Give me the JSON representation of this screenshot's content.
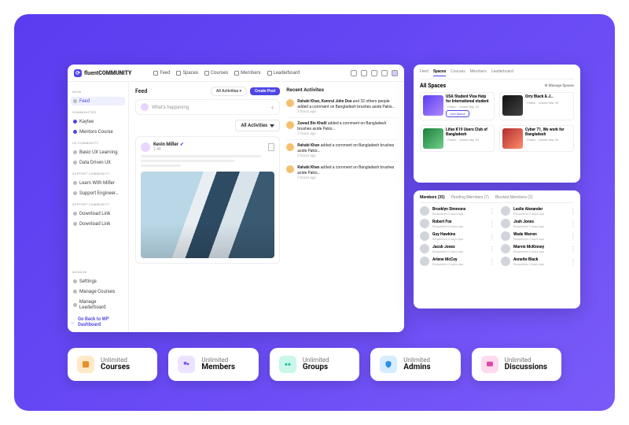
{
  "logo": {
    "brand_a": "fluent",
    "brand_b": "COMMUNITY"
  },
  "topnav": [
    {
      "label": "Feed"
    },
    {
      "label": "Spaces"
    },
    {
      "label": "Courses"
    },
    {
      "label": "Members"
    },
    {
      "label": "Leaderboard"
    }
  ],
  "sidebar": {
    "sections": {
      "main": "MAIN",
      "communities": "COMMUNITIES",
      "ux": "UX COMMUNITY",
      "support": "SUPPORT COMMUNITY",
      "support2": "SUPPORT COMMUNITY",
      "manage": "MANAGE"
    },
    "items": {
      "feed": "Feed",
      "kaytee": "Kaytee",
      "mentors": "Mentors Course",
      "basic_ux": "Basic UX Learning",
      "data_ux": "Data Driven UX",
      "learn_miller": "Learn With Miller",
      "support_eng": "Support Engineer…",
      "dl1": "Download Link",
      "dl2": "Download Link",
      "settings": "Settings",
      "manage_courses": "Manage Courses",
      "manage_leaderboard": "Manage Leaderboard",
      "go_back": "Go Back to WP Dashboard"
    }
  },
  "feed": {
    "title": "Feed",
    "all_activities_pill": "All Activities",
    "create_post": "Create Post",
    "composer_placeholder": "What's happening",
    "filter": "All Activities",
    "post": {
      "author": "Kevin Miller",
      "followers": "2.4K"
    }
  },
  "recent": {
    "title": "Recent Activites",
    "body_common": "Bangladesh brushes aside Pakis…",
    "action_common": "added a comment on",
    "items": [
      {
        "who": "Rahabi Khan, Kamrul John Doe",
        "extra": "and 32 others people",
        "time": "2 hours ago"
      },
      {
        "who": "Zawad Bin Khalil",
        "extra": "",
        "time": "2 hours ago"
      },
      {
        "who": "Rahabi Khan",
        "extra": "",
        "time": "2 hours ago"
      },
      {
        "who": "Rahabi Khan",
        "extra": "",
        "time": "2 hours ago"
      }
    ]
  },
  "spaces": {
    "tabs": [
      "Feed",
      "Spaces",
      "Courses",
      "Members",
      "Leaderboard"
    ],
    "title": "All Spaces",
    "manage": "Manage Spaces",
    "meta_public": "Public",
    "meta_date": "Joined Sep '23",
    "join": "Join Space",
    "items": [
      {
        "name": "USA Student Visa Help for International student"
      },
      {
        "name": "Orry Black & J…"
      },
      {
        "name": "Lifan K19 Users Club of Bangladesh"
      },
      {
        "name": "Cyber 71, We work for Bangladesh"
      }
    ]
  },
  "members": {
    "tabs": [
      "Members (35)",
      "Pending Members (7)",
      "Blocked Members (2)"
    ],
    "meta": "Requested 2 days ago",
    "items": [
      "Brooklyn Simmons",
      "Leslie Alexander",
      "Robert Fox",
      "Josh Jones",
      "Guy Hawkins",
      "Wade Warren",
      "Jacob Jones",
      "Marvin McKinney",
      "Arlene McCoy",
      "Annette Black"
    ]
  },
  "chips": [
    {
      "sub": "Unlimited",
      "title": "Courses"
    },
    {
      "sub": "Unlimited",
      "title": "Members"
    },
    {
      "sub": "Unlimited",
      "title": "Groups"
    },
    {
      "sub": "Unlimited",
      "title": "Admins"
    },
    {
      "sub": "Unlimited",
      "title": "Discussions"
    }
  ]
}
